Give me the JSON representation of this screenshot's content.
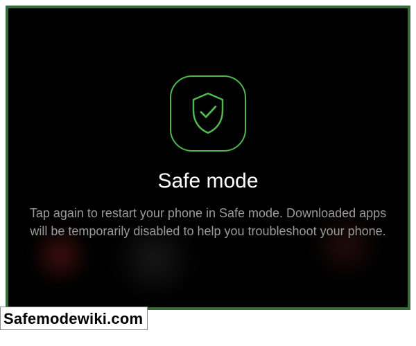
{
  "dialog": {
    "title": "Safe mode",
    "description": "Tap again to restart your phone in Safe mode. Downloaded apps will be temporarily disabled to help you troubleshoot your phone."
  },
  "watermark": {
    "text": "Safemodewiki.com"
  },
  "colors": {
    "accent": "#4fb84f",
    "frame": "#3a6b3a"
  }
}
